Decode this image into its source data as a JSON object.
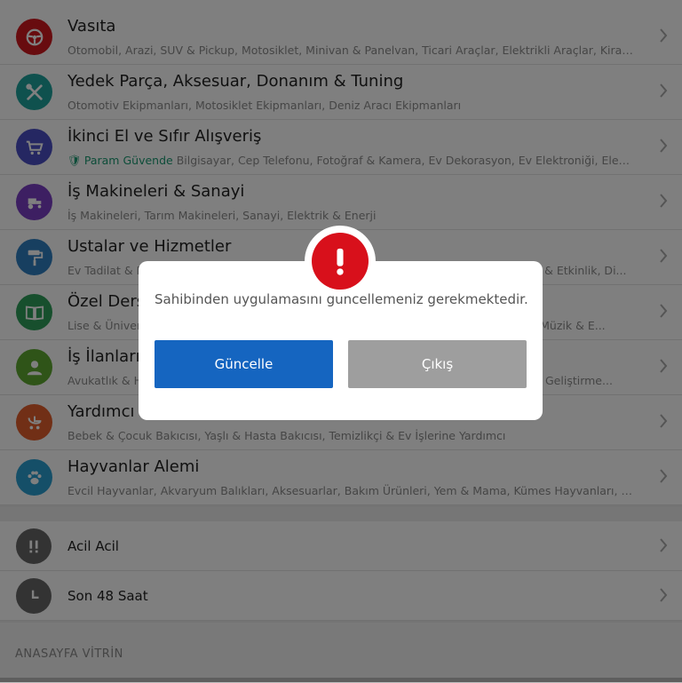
{
  "categories": [
    {
      "title": "Vasıta",
      "subtitle": "Otomobil, Arazi, SUV & Pickup, Motosiklet, Minivan & Panelvan, Ticari Araçlar, Elektrikli Araçlar, Kiralı...",
      "color": "#d0191f",
      "icon": "steering-wheel-icon"
    },
    {
      "title": "Yedek Parça, Aksesuar, Donanım & Tuning",
      "subtitle": "Otomotiv Ekipmanları, Motosiklet Ekipmanları, Deniz Aracı Ekipmanları",
      "color": "#1ea39c",
      "icon": "tools-icon"
    },
    {
      "title": "İkinci El ve Sıfır Alışveriş",
      "badge": "Param Güvende",
      "subtitle": "Bilgisayar, Cep Telefonu, Fotoğraf & Kamera, Ev Dekorasyon, Ev Elektroniği, Elekt...",
      "color": "#4a4fc4",
      "icon": "cart-icon"
    },
    {
      "title": "İş Makineleri & Sanayi",
      "subtitle": "İş Makineleri, Tarım Makineleri, Sanayi, Elektrik & Enerji",
      "color": "#7b3fc4",
      "icon": "tractor-icon"
    },
    {
      "title": "Ustalar ve Hizmetler",
      "subtitle": "Ev Tadilat & Dekorasyon, Nakliye, Araç Servis & Bakım, Tamir & Bakım, Organizasyon & Etkinlik, Di...",
      "color": "#2f7fc1",
      "icon": "paint-roller-icon"
    },
    {
      "title": "Özel Ders Verenler",
      "subtitle": "Lise & Üniversite, İlkokul & Ortaokul, Yabancı Dil, Bilgisayar, Direksiyon, Spor, Sanat, Müzik & E...",
      "color": "#2e9e5a",
      "icon": "book-icon"
    },
    {
      "title": "İş İlanları",
      "subtitle": "Avukatlık & Hukuki Danışmanlık, Eğitim, Eğlence & Aktivite, Güzellik & Bakım, Yazılım Geliştirme...",
      "color": "#5fa831",
      "icon": "person-icon"
    },
    {
      "title": "Yardımcı Arayanlar",
      "subtitle": "Bebek & Çocuk Bakıcısı, Yaşlı & Hasta Bakıcısı, Temizlikçi & Ev İşlerine Yardımcı",
      "color": "#e25e2c",
      "icon": "stroller-icon"
    },
    {
      "title": "Hayvanlar Alemi",
      "subtitle": "Evcil Hayvanlar, Akvaryum Balıkları, Aksesuarlar, Bakım Ürünleri, Yem & Mama, Kümes Hayvanları, B...",
      "color": "#2b9fd0",
      "icon": "paw-icon"
    }
  ],
  "quick_links": [
    {
      "title": "Acil Acil",
      "icon": "double-exclamation-icon"
    },
    {
      "title": "Son 48 Saat",
      "icon": "clock-icon"
    }
  ],
  "section_header": "ANASAYFA VİTRİN",
  "dialog": {
    "message": "Sahibinden uygulamasını güncellemeniz gerekmektedir.",
    "primary_button": "Güncelle",
    "secondary_button": "Çıkış",
    "alert_icon": "exclamation-icon",
    "alert_color": "#d8101b",
    "primary_color": "#1565c0",
    "secondary_color": "#9e9e9e"
  }
}
